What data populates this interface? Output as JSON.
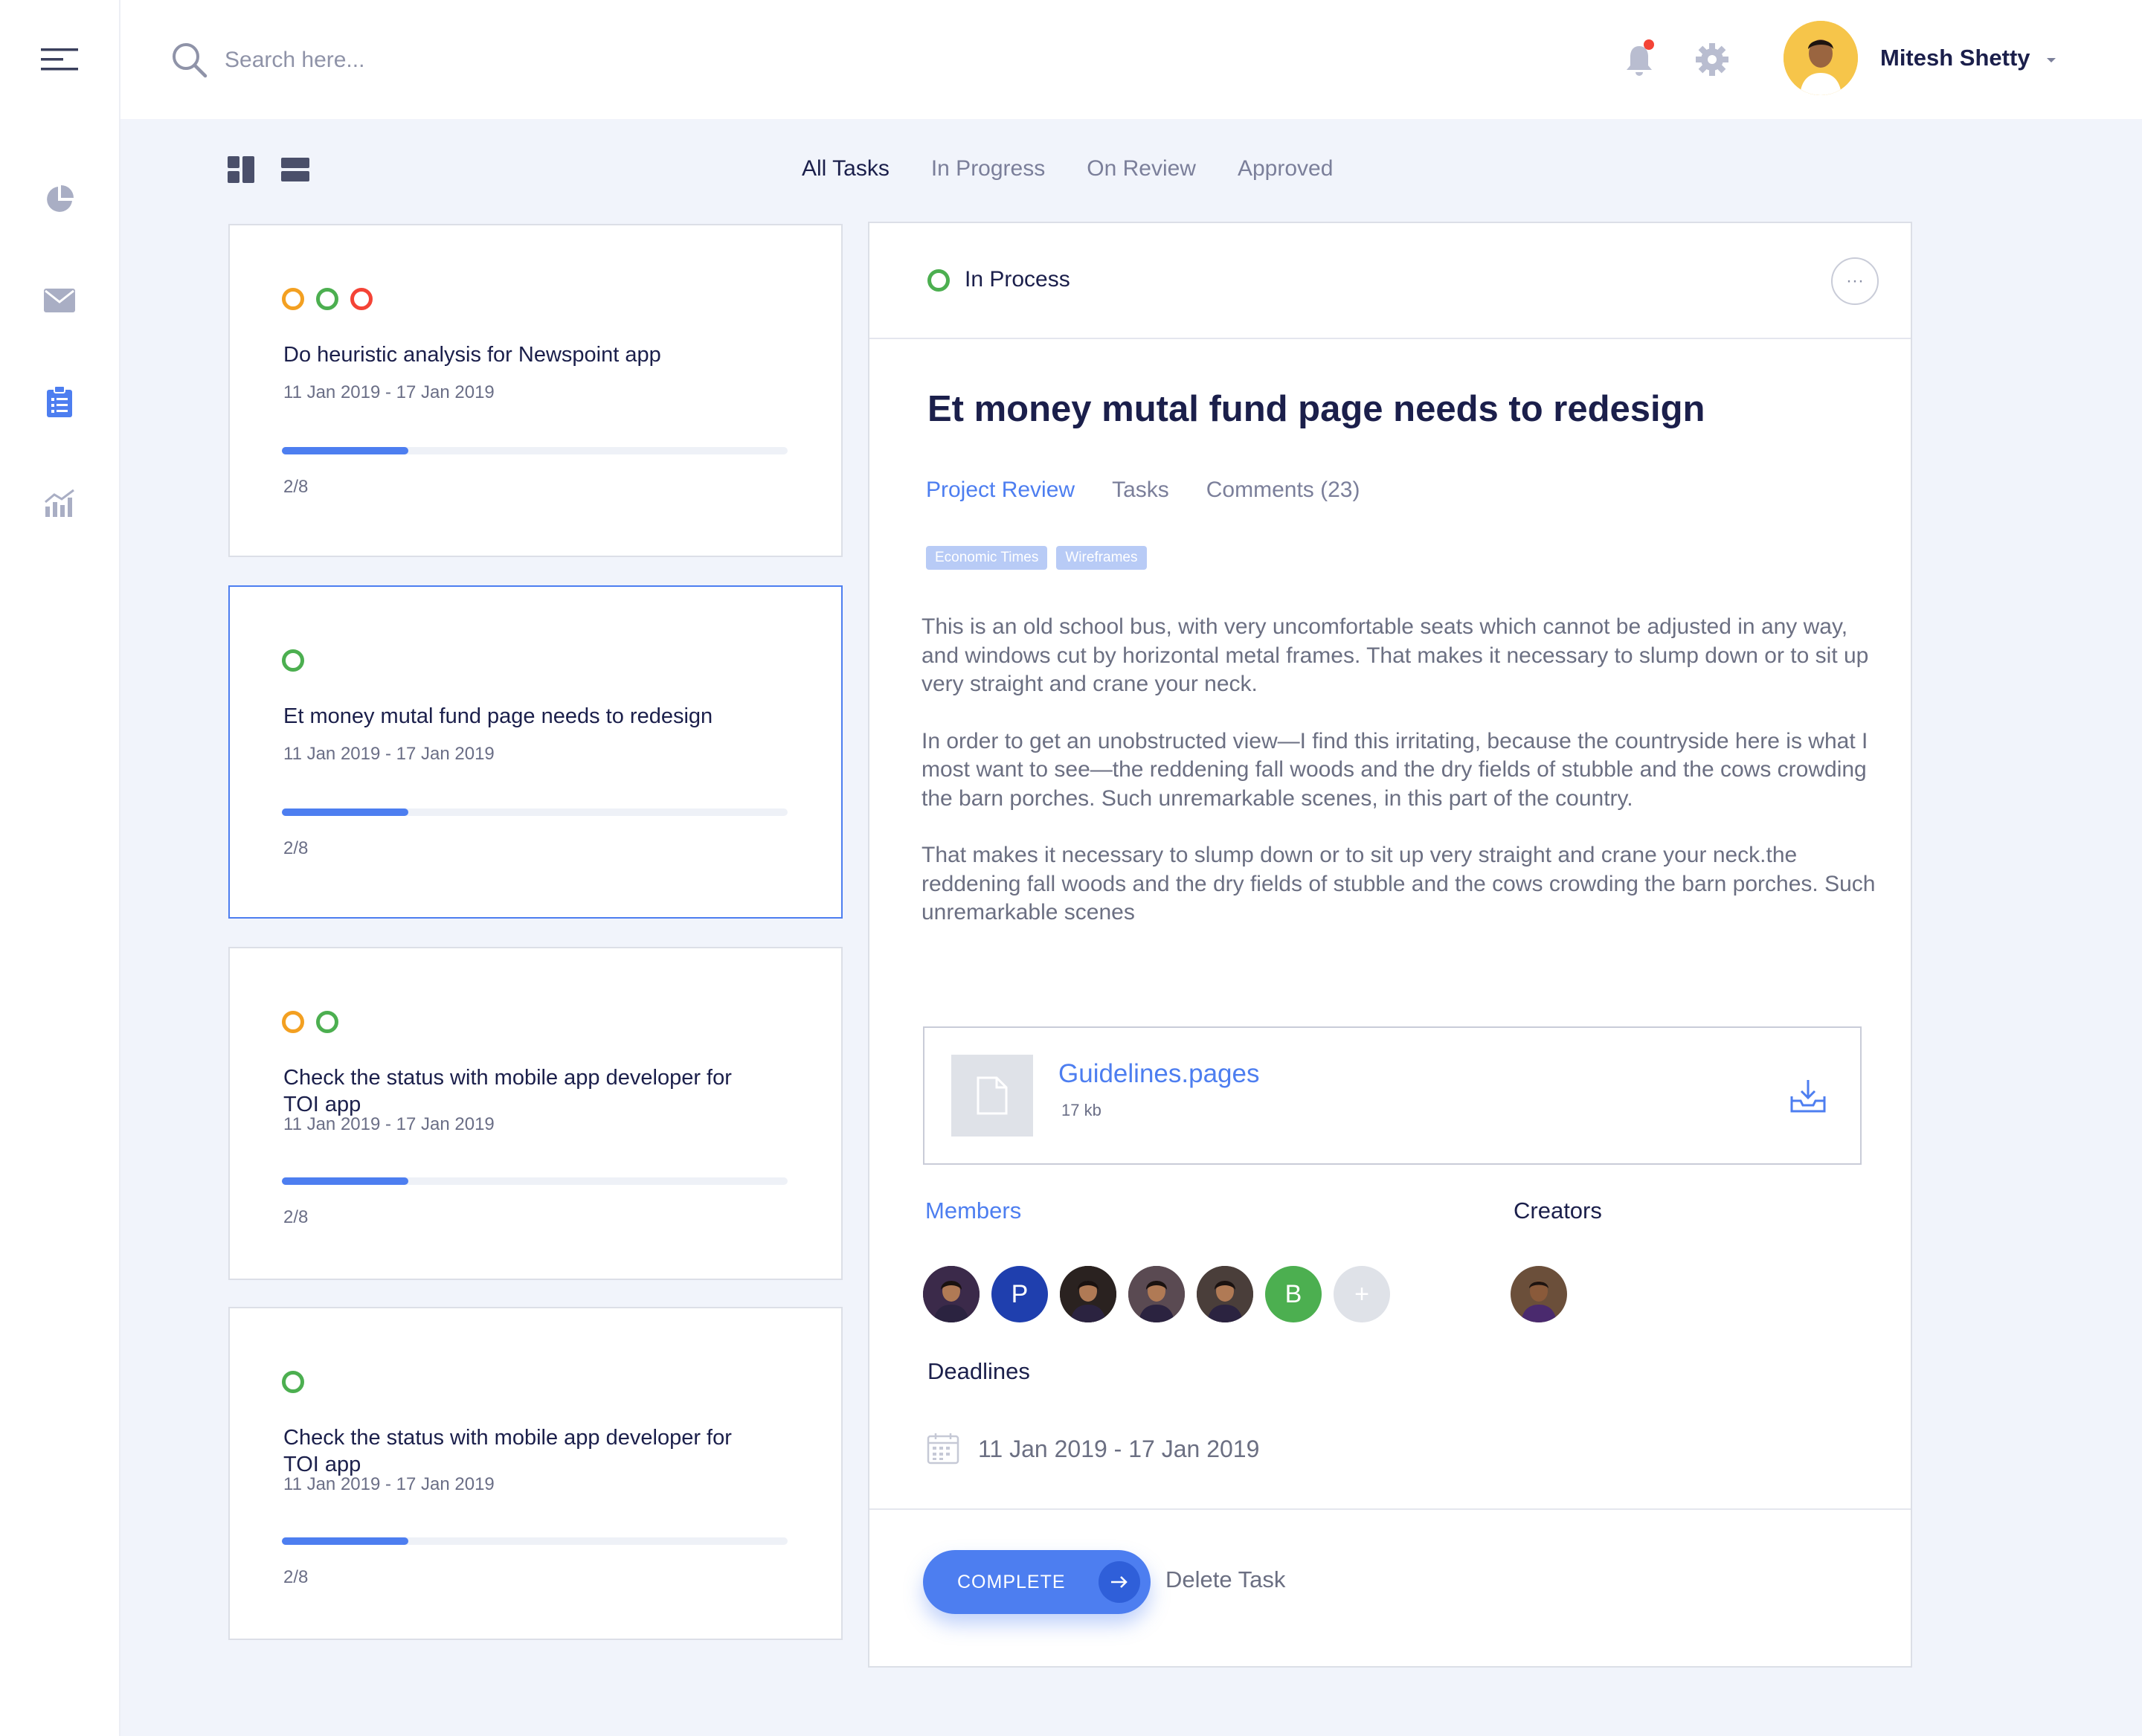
{
  "search": {
    "placeholder": "Search here..."
  },
  "user": {
    "name": "Mitesh Shetty"
  },
  "filter_tabs": [
    {
      "label": "All Tasks",
      "active": true
    },
    {
      "label": "In Progress",
      "active": false
    },
    {
      "label": "On Review",
      "active": false
    },
    {
      "label": "Approved",
      "active": false
    }
  ],
  "tasks": [
    {
      "title": "Do heuristic analysis for Newspoint app",
      "dates": "11 Jan 2019 - 17 Jan 2019",
      "progress_label": "2/8",
      "progress": 0.25,
      "dots": [
        "orange",
        "green",
        "red"
      ]
    },
    {
      "title": "Et money mutal fund page needs to redesign",
      "dates": "11 Jan 2019 - 17 Jan 2019",
      "progress_label": "2/8",
      "progress": 0.25,
      "dots": [
        "green"
      ]
    },
    {
      "title": "Check the status with mobile app developer for TOI app",
      "dates": "11 Jan 2019 - 17 Jan 2019",
      "progress_label": "2/8",
      "progress": 0.25,
      "dots": [
        "orange",
        "green"
      ]
    },
    {
      "title": "Check the status with mobile app developer for TOI app",
      "dates": "11 Jan 2019 - 17 Jan 2019",
      "progress_label": "2/8",
      "progress": 0.25,
      "dots": [
        "green"
      ]
    }
  ],
  "detail": {
    "status": "In Process",
    "more": "···",
    "title": "Et money mutal fund page needs to redesign",
    "tabs": [
      {
        "label": "Project Review",
        "active": true
      },
      {
        "label": "Tasks",
        "active": false
      },
      {
        "label": "Comments (23)",
        "active": false
      }
    ],
    "tags": [
      "Economic Times",
      "Wireframes"
    ],
    "paragraphs": [
      "This is an old school bus, with very uncomfortable seats which cannot be adjusted in any way, and windows cut by horizontal metal frames. That makes it necessary to slump down or to sit up very straight and crane your neck.",
      "In order to get an unobstructed view—I find this irritating, because the countryside here is what I most want to see—the reddening fall woods and the dry fields of stubble and the cows crowding the barn porches. Such unremarkable scenes, in this part of the country.",
      "That makes it necessary to slump down or to sit up very straight and crane your neck.the reddening fall woods and the dry fields of stubble and the cows crowding the barn porches. Such unremarkable scenes"
    ],
    "attachment": {
      "name": "Guidelines.pages",
      "size": "17 kb"
    },
    "members_label": "Members",
    "creators_label": "Creators",
    "members": [
      {
        "type": "photo",
        "color": "#3b2a4a"
      },
      {
        "type": "initial",
        "initial": "P",
        "color": "#1f3fae"
      },
      {
        "type": "photo",
        "color": "#2a2220"
      },
      {
        "type": "photo",
        "color": "#5a4a52"
      },
      {
        "type": "photo",
        "color": "#4a3e3a"
      },
      {
        "type": "initial",
        "initial": "B",
        "color": "#4caf50"
      },
      {
        "type": "add",
        "initial": "+",
        "color": "#dfe2e8"
      }
    ],
    "deadlines_label": "Deadlines",
    "deadline": "11 Jan 2019 - 17 Jan 2019",
    "complete_label": "COMPLETE",
    "delete_label": "Delete Task"
  },
  "colors": {
    "accent": "#4d7ef0",
    "green": "#4caf50",
    "orange": "#f3a021",
    "red": "#f44336",
    "background": "#f1f4fb"
  },
  "icons": [
    "menu-icon",
    "chart-pie-icon",
    "mail-icon",
    "clipboard-icon",
    "analytics-icon",
    "search-icon",
    "bell-icon",
    "gear-icon",
    "grid-view-icon",
    "list-view-icon",
    "file-icon",
    "download-icon",
    "calendar-icon",
    "arrow-right-icon",
    "chevron-down-icon"
  ]
}
